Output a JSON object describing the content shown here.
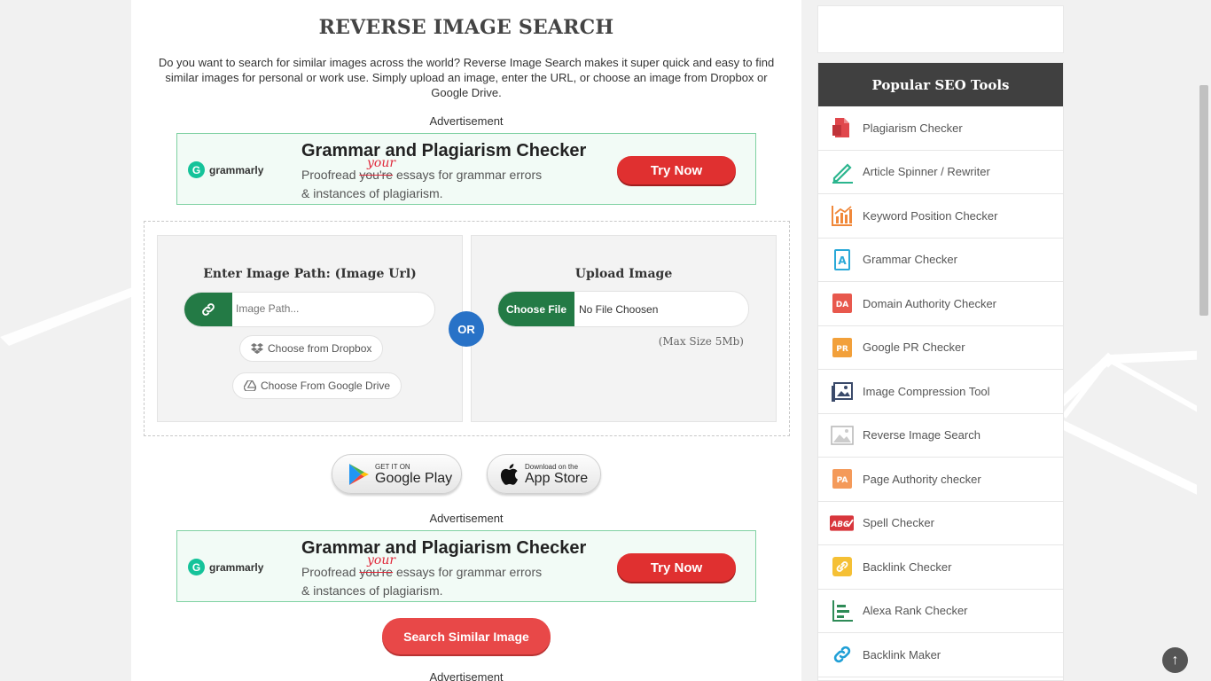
{
  "main": {
    "title": "REVERSE IMAGE SEARCH",
    "description": "Do you want to search for similar images across the world? Reverse Image Search makes it super quick and easy to find similar images for personal or work use. Simply upload an image, enter the URL, or choose an image from Dropbox or Google Drive.",
    "ad_label": "Advertisement",
    "ad": {
      "brand": "grammarly",
      "headline": "Grammar and Plagiarism Checker",
      "line1_pre": "Proofread ",
      "line1_struck": "you're",
      "line1_correction": "your",
      "line1_post": " essays for grammar errors",
      "line2": "& instances of plagiarism.",
      "cta": "Try Now"
    },
    "url_panel": {
      "title": "Enter Image Path: (Image Url)",
      "placeholder": "Image Path...",
      "dropbox": "Choose from Dropbox",
      "gdrive": "Choose From Google Drive"
    },
    "or_label": "OR",
    "upload_panel": {
      "title": "Upload Image",
      "choose_file": "Choose File",
      "file_status": "No File Choosen",
      "max_size": "(Max Size 5Mb)"
    },
    "stores": {
      "google_small": "GET IT ON",
      "google_big": "Google Play",
      "apple_small": "Download on the",
      "apple_big": "App Store"
    },
    "search_button": "Search Similar Image"
  },
  "sidebar": {
    "heading": "Popular SEO Tools",
    "items": [
      {
        "label": "Plagiarism Checker",
        "icon": "document-icon"
      },
      {
        "label": "Article Spinner / Rewriter",
        "icon": "pen-icon"
      },
      {
        "label": "Keyword Position Checker",
        "icon": "chart-icon"
      },
      {
        "label": "Grammar Checker",
        "icon": "grammar-icon"
      },
      {
        "label": "Domain Authority Checker",
        "icon": "da-icon"
      },
      {
        "label": "Google PR Checker",
        "icon": "pr-icon"
      },
      {
        "label": "Image Compression Tool",
        "icon": "image-compress-icon"
      },
      {
        "label": "Reverse Image Search",
        "icon": "image-icon"
      },
      {
        "label": "Page Authority checker",
        "icon": "pa-icon"
      },
      {
        "label": "Spell Checker",
        "icon": "spell-icon"
      },
      {
        "label": "Backlink Checker",
        "icon": "backlink-icon"
      },
      {
        "label": "Alexa Rank Checker",
        "icon": "rank-icon"
      },
      {
        "label": "Backlink Maker",
        "icon": "link-icon"
      }
    ]
  },
  "scroll_top": "↑",
  "colors": {
    "accent_green": "#237a45",
    "or_blue": "#2872c7",
    "search_red": "#e84848",
    "sidebar_head": "#404040"
  }
}
